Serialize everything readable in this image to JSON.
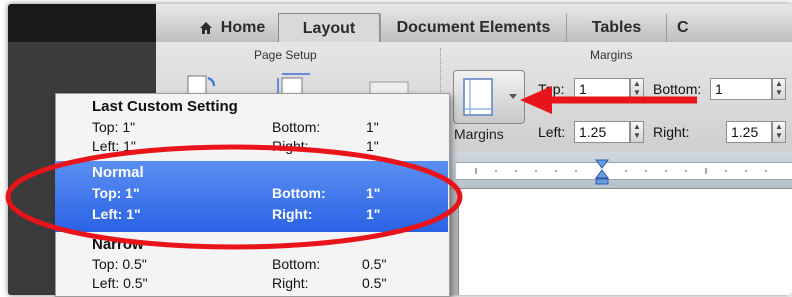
{
  "tabs": [
    {
      "label": "Home",
      "icon": "home-icon"
    },
    {
      "label": "Layout",
      "active": true
    },
    {
      "label": "Document Elements"
    },
    {
      "label": "Tables"
    },
    {
      "label": "C"
    }
  ],
  "page_setup": {
    "title": "Page Setup"
  },
  "margins_group": {
    "title": "Margins",
    "button_label": "Margins",
    "top_label": "Top:",
    "top_value": "1",
    "bottom_label": "Bottom:",
    "bottom_value": "1",
    "left_label": "Left:",
    "left_value": "1.25",
    "right_label": "Right:",
    "right_value": "1.25"
  },
  "menu": {
    "items": [
      {
        "title": "Last Custom Setting",
        "top": "Top: 1\"",
        "bottom_label": "Bottom:",
        "bottom": "1\"",
        "left": "Left: 1\"",
        "right_label": "Right:",
        "right": "1\""
      },
      {
        "title": "Normal",
        "top": "Top: 1\"",
        "bottom_label": "Bottom:",
        "bottom": "1\"",
        "left": "Left: 1\"",
        "right_label": "Right:",
        "right": "1\"",
        "selected": true
      },
      {
        "title": "Narrow",
        "top": "Top: 0.5\"",
        "bottom_label": "Bottom:",
        "bottom": "0.5\"",
        "left": "Left: 0.5\"",
        "right_label": "Right:",
        "right": "0.5\""
      }
    ]
  },
  "annotation_colors": {
    "arrow": "#e8141a",
    "ellipse": "#e8141a",
    "selection": "#2a62e4"
  }
}
